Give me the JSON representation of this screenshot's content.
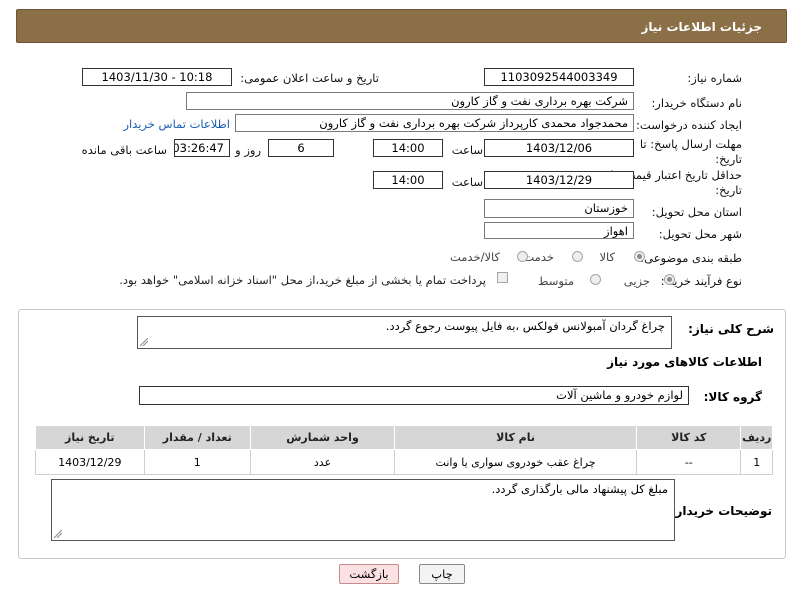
{
  "header": {
    "title": "جزئیات اطلاعات نیاز"
  },
  "form": {
    "need_number_label": "شماره نیاز:",
    "need_number": "1103092544003349",
    "announce_label": "تاریخ و ساعت اعلان عمومی:",
    "announce_value": "1403/11/30 - 10:18",
    "buyer_org_label": "نام دستگاه خریدار:",
    "buyer_org": "شرکت بهره برداری نفت و گاز کارون",
    "requester_label": "ایجاد کننده درخواست:",
    "requester": "محمدجواد محمدی کارپرداز شرکت بهره برداری نفت و گاز کارون",
    "contact_link": "اطلاعات تماس خریدار",
    "reply_deadline_label_1": "مهلت ارسال پاسخ: تا",
    "reply_deadline_label_2": "تاریخ:",
    "reply_date": "1403/12/06",
    "time_label": "ساعت",
    "reply_time": "14:00",
    "days_value": "6",
    "days_label": "روز و",
    "remaining_value": "03:26:47",
    "remaining_label": "ساعت باقی مانده",
    "price_validity_label_1": "حداقل تاریخ اعتبار قیمت: تا",
    "price_validity_label_2": "تاریخ:",
    "price_validity_date": "1403/12/29",
    "price_validity_time": "14:00",
    "province_label": "استان محل تحویل:",
    "province": "خوزستان",
    "city_label": "شهر محل تحویل:",
    "city": "اهواز",
    "category_label": "طبقه بندی موضوعی:",
    "category_options": [
      "کالا",
      "خدمت",
      "کالا/خدمت"
    ],
    "process_label": "نوع فرآیند خرید :",
    "process_options": [
      "جزیی",
      "متوسط"
    ],
    "payment_note": "پرداخت تمام یا بخشی از مبلغ خرید،از محل \"اسناد خزانه اسلامی\" خواهد بود."
  },
  "details": {
    "summary_label": "شرح کلی نیاز:",
    "summary": "چراغ گردان آمبولانس فولکس ،به فایل پیوست رجوع گردد.",
    "goods_info_title": "اطلاعات کالاهای مورد نیاز",
    "goods_group_label": "گروه کالا:",
    "goods_group": "لوازم خودرو و ماشین آلات"
  },
  "table": {
    "headers": [
      "ردیف",
      "کد کالا",
      "نام کالا",
      "واحد شمارش",
      "تعداد / مقدار",
      "تاریخ نیاز"
    ],
    "rows": [
      [
        "1",
        "--",
        "چراغ عقب خودروی سواری یا وانت",
        "عدد",
        "1",
        "1403/12/29"
      ]
    ]
  },
  "buyer_notes": {
    "label": "توضیحات خریدار:",
    "text": "مبلغ کل پیشنهاد مالی بارگذاری گردد."
  },
  "buttons": {
    "print": "چاپ",
    "back": "بازگشت"
  },
  "colors": {
    "header_bg": "#8b6f47",
    "link": "#1a5fb4",
    "back_button_bg": "#fbe1e1"
  }
}
